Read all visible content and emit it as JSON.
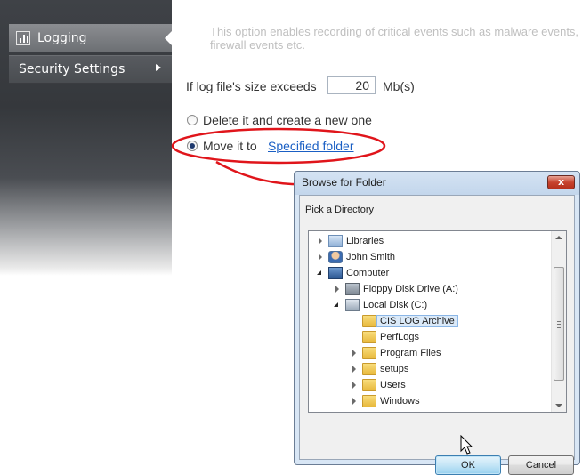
{
  "sidebar": {
    "items": [
      {
        "label": "Logging",
        "icon": "bar-chart-icon"
      },
      {
        "label": "Security Settings",
        "icon": "chevron-right-icon"
      }
    ]
  },
  "main": {
    "description_line1": "This option enables recording of critical events such as malware events,",
    "description_line2": "firewall events etc.",
    "size_label": "If log file's size exceeds",
    "size_value": "20",
    "size_unit": "Mb(s)",
    "option_delete": "Delete it and create a new one",
    "option_move": "Move it to",
    "folder_link": "Specified folder",
    "selected_option": "move"
  },
  "dialog": {
    "title": "Browse for Folder",
    "close_label": "x",
    "prompt": "Pick a Directory",
    "tree": [
      {
        "label": "Libraries",
        "icon": "library-icon",
        "toggle": "closed"
      },
      {
        "label": "John Smith",
        "icon": "user-icon",
        "toggle": "closed"
      },
      {
        "label": "Computer",
        "icon": "computer-icon",
        "toggle": "open"
      },
      {
        "label": "Floppy Disk Drive (A:)",
        "icon": "floppy-drive-icon",
        "toggle": "closed"
      },
      {
        "label": "Local Disk (C:)",
        "icon": "local-disk-icon",
        "toggle": "open"
      },
      {
        "label": "CIS LOG Archive",
        "icon": "folder-icon",
        "toggle": "none",
        "selected": true
      },
      {
        "label": "PerfLogs",
        "icon": "folder-icon",
        "toggle": "none"
      },
      {
        "label": "Program Files",
        "icon": "folder-icon",
        "toggle": "closed"
      },
      {
        "label": "setups",
        "icon": "folder-icon",
        "toggle": "closed"
      },
      {
        "label": "Users",
        "icon": "folder-icon",
        "toggle": "closed"
      },
      {
        "label": "Windows",
        "icon": "folder-icon",
        "toggle": "closed"
      }
    ],
    "ok_label": "OK",
    "cancel_label": "Cancel"
  },
  "colors": {
    "annotation": "#e0151b",
    "link": "#1a5fc4",
    "sidebar_dark": "#35383c"
  }
}
